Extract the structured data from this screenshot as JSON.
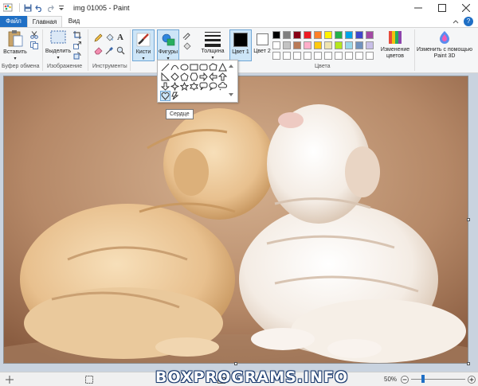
{
  "window": {
    "title": "img 01005 - Paint"
  },
  "tabs": {
    "file": "Файл",
    "home": "Главная",
    "view": "Вид"
  },
  "ribbon": {
    "clipboard": {
      "paste": "Вставить",
      "group": "Буфер обмена"
    },
    "image": {
      "select": "Выделить",
      "group": "Изображение"
    },
    "tools": {
      "group": "Инструменты"
    },
    "brushes": "Кисти",
    "shapes": "Фигуры",
    "size": "Толщина",
    "color1": "Цвет 1",
    "color2": "Цвет 2",
    "colors_group": "Цвета",
    "edit_colors": "Изменение цветов",
    "paint3d": "Изменить с помощью Paint 3D"
  },
  "palette": {
    "row1": [
      "#000000",
      "#7f7f7f",
      "#880015",
      "#ed1c24",
      "#ff7f27",
      "#fff200",
      "#22b14c",
      "#00a2e8",
      "#3f48cc",
      "#a349a4"
    ],
    "row2": [
      "#ffffff",
      "#c3c3c3",
      "#b97a57",
      "#ffaec9",
      "#ffc90e",
      "#efe4b0",
      "#b5e61d",
      "#99d9ea",
      "#7092be",
      "#c8bfe7"
    ],
    "color1": "#000000",
    "color2": "#ffffff"
  },
  "shapes_dropdown": {
    "icons": [
      "line-icon",
      "curve-icon",
      "oval-icon",
      "rectangle-icon",
      "rounded-rectangle-icon",
      "polygon-icon",
      "triangle-icon",
      "right-triangle-icon",
      "diamond-icon",
      "pentagon-icon",
      "hexagon-icon",
      "right-arrow-icon",
      "left-arrow-icon",
      "up-arrow-icon",
      "down-arrow-icon",
      "four-point-star-icon",
      "five-point-star-icon",
      "six-point-star-icon",
      "rounded-callout-icon",
      "oval-callout-icon",
      "cloud-callout-icon",
      "heart-icon",
      "lightning-icon"
    ],
    "tooltip": "Сердце"
  },
  "status": {
    "watermark": "BOXPROGRAMS.INFO",
    "zoom": "50%"
  }
}
